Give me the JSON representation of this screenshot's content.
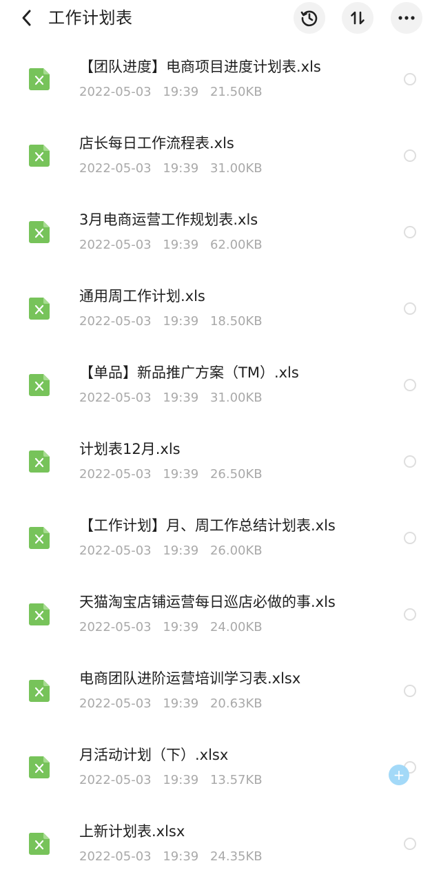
{
  "header": {
    "title": "工作计划表",
    "icons": {
      "back": "chevron-left-icon",
      "history": "history-clock-icon",
      "sort": "sort-arrows-icon",
      "more": "more-dots-icon"
    }
  },
  "colors": {
    "file_icon": "#77c35a",
    "meta_text": "#a9a9a9",
    "add_button": "#9fd8f8"
  },
  "files": [
    {
      "name": "【团队进度】电商项目进度计划表.xls",
      "date": "2022-05-03",
      "time": "19:39",
      "size": "21.50KB"
    },
    {
      "name": "店长每日工作流程表.xls",
      "date": "2022-05-03",
      "time": "19:39",
      "size": "31.00KB"
    },
    {
      "name": "3月电商运营工作规划表.xls",
      "date": "2022-05-03",
      "time": "19:39",
      "size": "62.00KB"
    },
    {
      "name": "通用周工作计划.xls",
      "date": "2022-05-03",
      "time": "19:39",
      "size": "18.50KB"
    },
    {
      "name": "【单品】新品推广方案（TM）.xls",
      "date": "2022-05-03",
      "time": "19:39",
      "size": "31.00KB"
    },
    {
      "name": "计划表12月.xls",
      "date": "2022-05-03",
      "time": "19:39",
      "size": "26.50KB"
    },
    {
      "name": "【工作计划】月、周工作总结计划表.xls",
      "date": "2022-05-03",
      "time": "19:39",
      "size": "26.00KB"
    },
    {
      "name": "天猫淘宝店铺运营每日巡店必做的事.xls",
      "date": "2022-05-03",
      "time": "19:39",
      "size": "24.00KB"
    },
    {
      "name": "电商团队进阶运营培训学习表.xlsx",
      "date": "2022-05-03",
      "time": "19:39",
      "size": "20.63KB"
    },
    {
      "name": "月活动计划（下）.xlsx",
      "date": "2022-05-03",
      "time": "19:39",
      "size": "13.57KB"
    },
    {
      "name": "上新计划表.xlsx",
      "date": "2022-05-03",
      "time": "19:39",
      "size": "24.35KB"
    }
  ],
  "fab": {
    "label": "+",
    "icon": "plus-icon"
  }
}
